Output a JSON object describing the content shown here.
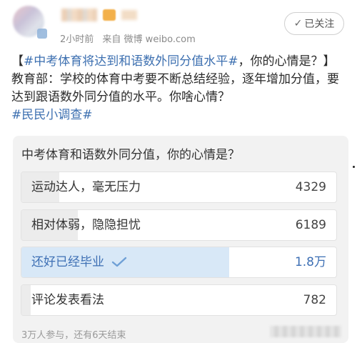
{
  "header": {
    "time": "2小时前",
    "source": "来自 微博 weibo.com",
    "follow_label": "已关注",
    "follow_icon": "check-icon"
  },
  "post": {
    "topic_open": "【",
    "topic_tag": "#中考体育将达到和语数外同分值水平#",
    "body": "，你的心情是？】教育部：学校的体育中考要不断总结经验，逐年增加分值，要达到跟语数外同分值的水平。你啥心情？",
    "survey_tag": "#民民小调查#"
  },
  "poll": {
    "title": "中考体育和语数外同分值，你的心情是？",
    "options": [
      {
        "label": "运动达人，毫无压力",
        "votes": "4329",
        "share": 0.12,
        "selected": false
      },
      {
        "label": "相对体弱，隐隐担忧",
        "votes": "6189",
        "share": 0.18,
        "selected": false
      },
      {
        "label": "还好已经毕业",
        "votes": "1.8万",
        "share": 0.66,
        "selected": true
      },
      {
        "label": "评论发表看法",
        "votes": "782",
        "share": 0.03,
        "selected": false
      }
    ],
    "footer": "3万人参与，还有6天结束",
    "selected_color": "#3d6fb4"
  }
}
